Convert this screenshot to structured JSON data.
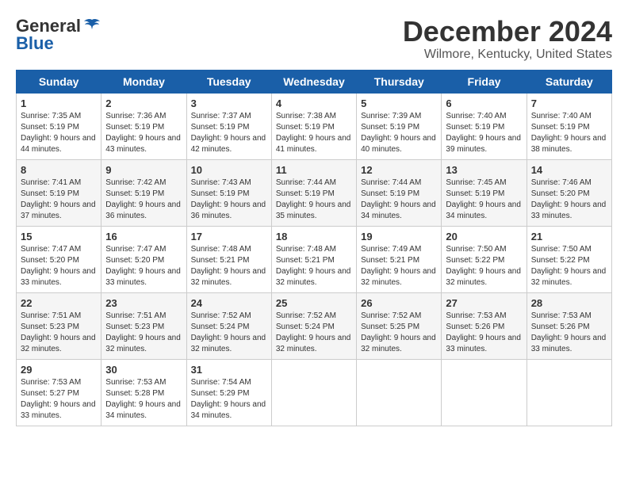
{
  "header": {
    "logo_general": "General",
    "logo_blue": "Blue",
    "month_title": "December 2024",
    "location": "Wilmore, Kentucky, United States"
  },
  "weekdays": [
    "Sunday",
    "Monday",
    "Tuesday",
    "Wednesday",
    "Thursday",
    "Friday",
    "Saturday"
  ],
  "weeks": [
    [
      {
        "day": "1",
        "sunrise": "7:35 AM",
        "sunset": "5:19 PM",
        "daylight": "9 hours and 44 minutes."
      },
      {
        "day": "2",
        "sunrise": "7:36 AM",
        "sunset": "5:19 PM",
        "daylight": "9 hours and 43 minutes."
      },
      {
        "day": "3",
        "sunrise": "7:37 AM",
        "sunset": "5:19 PM",
        "daylight": "9 hours and 42 minutes."
      },
      {
        "day": "4",
        "sunrise": "7:38 AM",
        "sunset": "5:19 PM",
        "daylight": "9 hours and 41 minutes."
      },
      {
        "day": "5",
        "sunrise": "7:39 AM",
        "sunset": "5:19 PM",
        "daylight": "9 hours and 40 minutes."
      },
      {
        "day": "6",
        "sunrise": "7:40 AM",
        "sunset": "5:19 PM",
        "daylight": "9 hours and 39 minutes."
      },
      {
        "day": "7",
        "sunrise": "7:40 AM",
        "sunset": "5:19 PM",
        "daylight": "9 hours and 38 minutes."
      }
    ],
    [
      {
        "day": "8",
        "sunrise": "7:41 AM",
        "sunset": "5:19 PM",
        "daylight": "9 hours and 37 minutes."
      },
      {
        "day": "9",
        "sunrise": "7:42 AM",
        "sunset": "5:19 PM",
        "daylight": "9 hours and 36 minutes."
      },
      {
        "day": "10",
        "sunrise": "7:43 AM",
        "sunset": "5:19 PM",
        "daylight": "9 hours and 36 minutes."
      },
      {
        "day": "11",
        "sunrise": "7:44 AM",
        "sunset": "5:19 PM",
        "daylight": "9 hours and 35 minutes."
      },
      {
        "day": "12",
        "sunrise": "7:44 AM",
        "sunset": "5:19 PM",
        "daylight": "9 hours and 34 minutes."
      },
      {
        "day": "13",
        "sunrise": "7:45 AM",
        "sunset": "5:19 PM",
        "daylight": "9 hours and 34 minutes."
      },
      {
        "day": "14",
        "sunrise": "7:46 AM",
        "sunset": "5:20 PM",
        "daylight": "9 hours and 33 minutes."
      }
    ],
    [
      {
        "day": "15",
        "sunrise": "7:47 AM",
        "sunset": "5:20 PM",
        "daylight": "9 hours and 33 minutes."
      },
      {
        "day": "16",
        "sunrise": "7:47 AM",
        "sunset": "5:20 PM",
        "daylight": "9 hours and 33 minutes."
      },
      {
        "day": "17",
        "sunrise": "7:48 AM",
        "sunset": "5:21 PM",
        "daylight": "9 hours and 32 minutes."
      },
      {
        "day": "18",
        "sunrise": "7:48 AM",
        "sunset": "5:21 PM",
        "daylight": "9 hours and 32 minutes."
      },
      {
        "day": "19",
        "sunrise": "7:49 AM",
        "sunset": "5:21 PM",
        "daylight": "9 hours and 32 minutes."
      },
      {
        "day": "20",
        "sunrise": "7:50 AM",
        "sunset": "5:22 PM",
        "daylight": "9 hours and 32 minutes."
      },
      {
        "day": "21",
        "sunrise": "7:50 AM",
        "sunset": "5:22 PM",
        "daylight": "9 hours and 32 minutes."
      }
    ],
    [
      {
        "day": "22",
        "sunrise": "7:51 AM",
        "sunset": "5:23 PM",
        "daylight": "9 hours and 32 minutes."
      },
      {
        "day": "23",
        "sunrise": "7:51 AM",
        "sunset": "5:23 PM",
        "daylight": "9 hours and 32 minutes."
      },
      {
        "day": "24",
        "sunrise": "7:52 AM",
        "sunset": "5:24 PM",
        "daylight": "9 hours and 32 minutes."
      },
      {
        "day": "25",
        "sunrise": "7:52 AM",
        "sunset": "5:24 PM",
        "daylight": "9 hours and 32 minutes."
      },
      {
        "day": "26",
        "sunrise": "7:52 AM",
        "sunset": "5:25 PM",
        "daylight": "9 hours and 32 minutes."
      },
      {
        "day": "27",
        "sunrise": "7:53 AM",
        "sunset": "5:26 PM",
        "daylight": "9 hours and 33 minutes."
      },
      {
        "day": "28",
        "sunrise": "7:53 AM",
        "sunset": "5:26 PM",
        "daylight": "9 hours and 33 minutes."
      }
    ],
    [
      {
        "day": "29",
        "sunrise": "7:53 AM",
        "sunset": "5:27 PM",
        "daylight": "9 hours and 33 minutes."
      },
      {
        "day": "30",
        "sunrise": "7:53 AM",
        "sunset": "5:28 PM",
        "daylight": "9 hours and 34 minutes."
      },
      {
        "day": "31",
        "sunrise": "7:54 AM",
        "sunset": "5:29 PM",
        "daylight": "9 hours and 34 minutes."
      },
      null,
      null,
      null,
      null
    ]
  ]
}
